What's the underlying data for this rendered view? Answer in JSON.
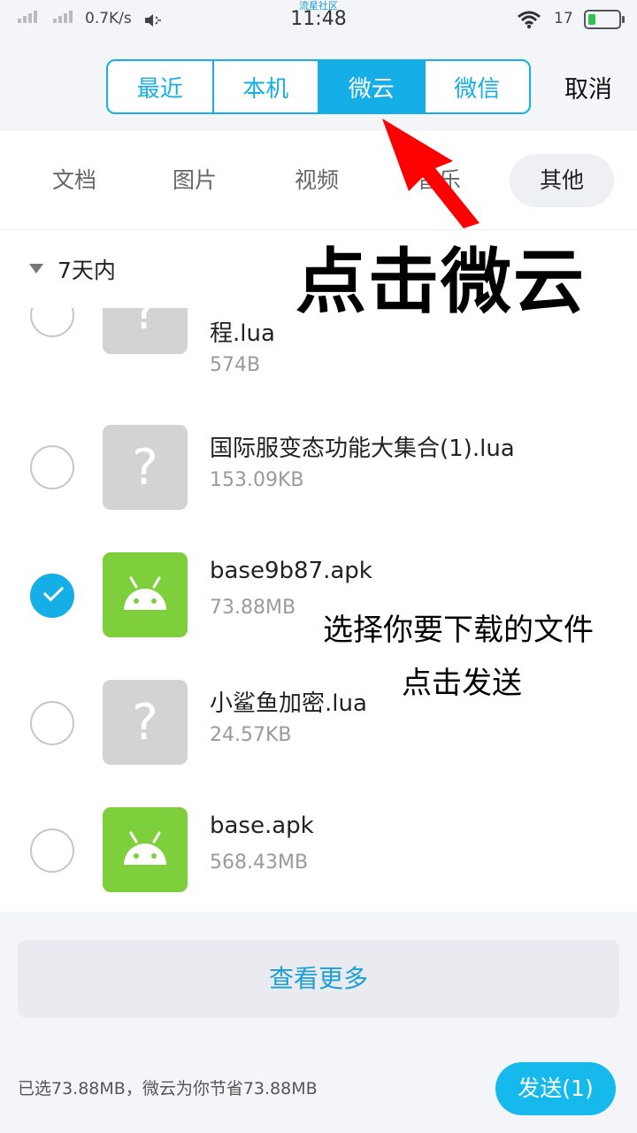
{
  "status_bar": {
    "net_speed": "0.7K/s",
    "site_label": "流星社区",
    "time": "11:48",
    "battery_level": "17",
    "battery_color": "#2ec24d"
  },
  "header": {
    "tabs": [
      {
        "label": "最近",
        "active": false
      },
      {
        "label": "本机",
        "active": false
      },
      {
        "label": "微云",
        "active": true
      },
      {
        "label": "微信",
        "active": false
      }
    ],
    "cancel_label": "取消",
    "accent": "#16aee6"
  },
  "categories": [
    {
      "label": "文档",
      "active": false
    },
    {
      "label": "图片",
      "active": false
    },
    {
      "label": "视频",
      "active": false
    },
    {
      "label": "音乐",
      "active": false
    },
    {
      "label": "其他",
      "active": true
    }
  ],
  "group": {
    "title": "7天内"
  },
  "files": [
    {
      "name": "程.lua",
      "size": "574B",
      "icon": "unknown-file-icon",
      "checked": false
    },
    {
      "name": "国际服变态功能大集合(1).lua",
      "size": "153.09KB",
      "icon": "unknown-file-icon",
      "checked": false
    },
    {
      "name": "base9b87.apk",
      "size": "73.88MB",
      "icon": "android-icon",
      "checked": true
    },
    {
      "name": "小鲨鱼加密.lua",
      "size": "24.57KB",
      "icon": "unknown-file-icon",
      "checked": false
    },
    {
      "name": "base.apk",
      "size": "568.43MB",
      "icon": "android-icon",
      "checked": false
    }
  ],
  "view_more_label": "查看更多",
  "footer": {
    "info": "已选73.88MB，微云为你节省73.88MB",
    "send_label": "发送(1)"
  },
  "annotations": {
    "main": "点击微云",
    "line1": "选择你要下载的文件",
    "line2": "点击发送",
    "arrow_color": "#ff0000"
  }
}
